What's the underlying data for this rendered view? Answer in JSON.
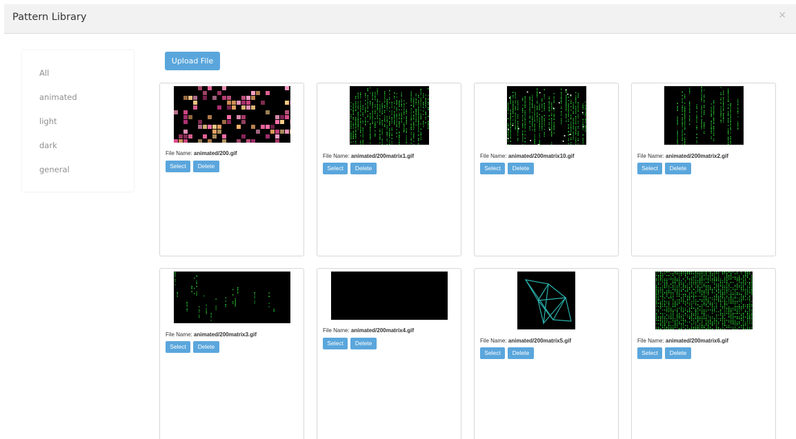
{
  "modal": {
    "title": "Pattern Library",
    "close_label": "×"
  },
  "sidebar": {
    "items": [
      {
        "label": "All"
      },
      {
        "label": "animated"
      },
      {
        "label": "light"
      },
      {
        "label": "dark"
      },
      {
        "label": "general"
      }
    ]
  },
  "toolbar": {
    "upload_label": "Upload File"
  },
  "card_labels": {
    "file_name_prefix": "File Name: ",
    "select": "Select",
    "delete": "Delete"
  },
  "files": [
    {
      "name": "animated/200.gif"
    },
    {
      "name": "animated/200matrix1.gif"
    },
    {
      "name": "animated/200matrix10.gif"
    },
    {
      "name": "animated/200matrix2.gif"
    },
    {
      "name": "animated/200matrix3.gif"
    },
    {
      "name": "animated/200matrix4.gif"
    },
    {
      "name": "animated/200matrix5.gif"
    },
    {
      "name": "animated/200matrix6.gif"
    }
  ],
  "colors": {
    "accent": "#5aa6dc",
    "header_bg": "#f2f2f2",
    "matrix_green": "#2ecc40"
  }
}
